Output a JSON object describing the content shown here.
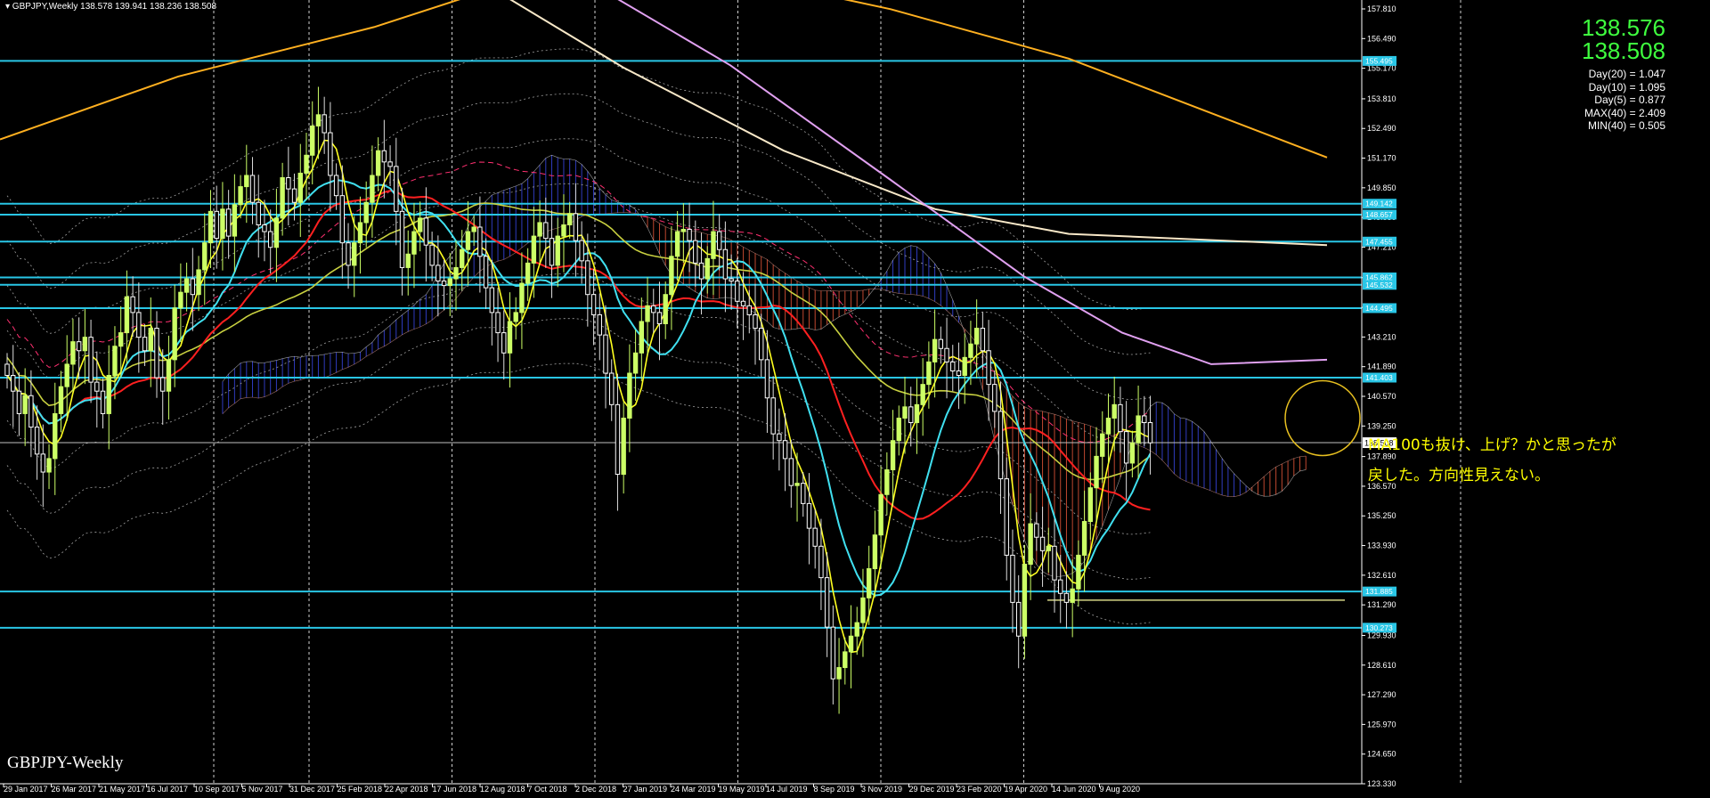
{
  "header": {
    "symbol_line": "▾ GBPJPY,Weekly  138.578 139.941 138.236 138.508",
    "bottom_label": "GBPJPY-Weekly"
  },
  "quote": {
    "bid": "138.576",
    "ask": "138.508"
  },
  "stats": [
    "Day(20) = 1.047",
    "Day(10) = 1.095",
    "Day(5) = 0.877",
    "MAX(40) = 2.409",
    "MIN(40) = 0.505"
  ],
  "annotation": {
    "line1": "MA100も抜け、上げ？かと思ったが",
    "line2": "戻した。方向性見えない。"
  },
  "colors": {
    "background": "#000000",
    "bull_candle": "#ccff66",
    "bear_candle": "#ffffff",
    "horizontal_level": "#29c6e6",
    "ma_red": "#ff2020",
    "ma_cyan": "#40e0f0",
    "ma_yellow": "#ffff20",
    "ma_olive": "#c8d040",
    "ma_orange": "#ffb020",
    "ma_white": "#f8e8c8",
    "ma_violet": "#e0a0f0",
    "cloud_bear": "#ff6040",
    "cloud_bull": "#4050ff",
    "annotation": "#ffff00",
    "circle": "#e8c020"
  },
  "chart_data": {
    "type": "candlestick",
    "symbol": "GBPJPY",
    "timeframe": "Weekly",
    "ylim": [
      123.33,
      157.81
    ],
    "y_ticks": [
      "157.810",
      "156.490",
      "155.170",
      "153.810",
      "152.490",
      "151.170",
      "149.850",
      "148.530",
      "147.210",
      "145.850",
      "144.530",
      "143.210",
      "141.890",
      "140.570",
      "139.250",
      "137.890",
      "136.570",
      "135.250",
      "133.930",
      "132.610",
      "131.290",
      "129.930",
      "128.610",
      "127.290",
      "125.970",
      "124.650",
      "123.330"
    ],
    "x_labels": [
      "29 Jan 2017",
      "26 Mar 2017",
      "21 May 2017",
      "16 Jul 2017",
      "10 Sep 2017",
      "5 Nov 2017",
      "31 Dec 2017",
      "25 Feb 2018",
      "22 Apr 2018",
      "17 Jun 2018",
      "12 Aug 2018",
      "7 Oct 2018",
      "2 Dec 2018",
      "27 Jan 2019",
      "24 Mar 2019",
      "19 May 2019",
      "14 Jul 2019",
      "8 Sep 2019",
      "3 Nov 2019",
      "29 Dec 2019",
      "23 Feb 2020",
      "19 Apr 2020",
      "14 Jun 2020",
      "9 Aug 2020"
    ],
    "vertical_grid_labels": [
      "10 Sep 2017",
      "31 Dec 2017",
      "17 Jun 2018",
      "2 Dec 2018",
      "19 May 2019",
      "3 Nov 2019",
      "19 Apr 2020"
    ],
    "horizontal_levels": [
      {
        "price": 155.495,
        "label": "155.495"
      },
      {
        "price": 149.142,
        "label": "149.142"
      },
      {
        "price": 148.657,
        "label": "148.657"
      },
      {
        "price": 147.455,
        "label": "147.455"
      },
      {
        "price": 145.862,
        "label": "145.862"
      },
      {
        "price": 145.532,
        "label": "145.532"
      },
      {
        "price": 144.495,
        "label": "144.495"
      },
      {
        "price": 141.403,
        "label": "141.403"
      },
      {
        "price": 131.885,
        "label": "131.885"
      },
      {
        "price": 130.273,
        "label": "130.273"
      }
    ],
    "current_price": {
      "price": 138.508,
      "label": "138.508"
    },
    "close_series": [
      141.5,
      140.8,
      139.8,
      140.6,
      139.2,
      138.0,
      137.2,
      137.8,
      139.8,
      141.0,
      142.0,
      143.0,
      142.6,
      143.2,
      141.2,
      140.8,
      139.8,
      141.5,
      142.8,
      143.4,
      145.0,
      144.3,
      143.2,
      142.6,
      143.6,
      141.4,
      140.8,
      142.2,
      144.5,
      145.2,
      145.8,
      145.1,
      146.2,
      147.4,
      148.8,
      147.6,
      148.9,
      147.7,
      149.1,
      149.9,
      150.4,
      149.2,
      148.2,
      147.9,
      147.2,
      148.5,
      150.3,
      149.8,
      149.2,
      150.5,
      151.3,
      152.6,
      153.1,
      152.3,
      150.4,
      149.5,
      147.4,
      146.4,
      147.4,
      148.3,
      149.2,
      150.4,
      151.5,
      151.0,
      150.8,
      148.8,
      146.3,
      146.9,
      147.9,
      148.5,
      147.3,
      146.4,
      145.7,
      145.5,
      145.8,
      146.3,
      147.1,
      147.9,
      148.1,
      146.8,
      145.4,
      144.3,
      143.4,
      142.5,
      143.9,
      144.3,
      145.6,
      146.5,
      147.7,
      148.3,
      147.6,
      146.4,
      147.7,
      148.2,
      148.7,
      147.5,
      146.6,
      145.1,
      144.2,
      143.3,
      141.6,
      140.2,
      137.1,
      139.6,
      141.6,
      142.5,
      143.9,
      144.6,
      144.3,
      143.8,
      145.1,
      146.8,
      147.9,
      148.0,
      147.5,
      146.5,
      145.8,
      146.7,
      147.9,
      147.1,
      145.8,
      145.7,
      144.8,
      144.6,
      144.2,
      143.6,
      142.2,
      140.5,
      138.9,
      138.6,
      137.8,
      136.6,
      136.7,
      135.8,
      134.7,
      133.9,
      132.5,
      130.3,
      128.0,
      128.5,
      129.2,
      129.9,
      130.5,
      131.6,
      132.9,
      134.4,
      136.2,
      137.3,
      138.6,
      139.6,
      140.1,
      139.4,
      140.2,
      141.1,
      142.1,
      143.1,
      142.7,
      142.1,
      141.7,
      141.5,
      142.3,
      142.9,
      143.6,
      142.6,
      141.1,
      139.9,
      136.9,
      133.5,
      131.4,
      129.9,
      133.1,
      134.9,
      134.3,
      133.7,
      133.9,
      132.4,
      131.8,
      131.4,
      132.0,
      133.5,
      135.0,
      136.5,
      137.9,
      138.9,
      139.6,
      140.2,
      139.0,
      137.6,
      138.5,
      139.7,
      139.4,
      138.5
    ]
  }
}
